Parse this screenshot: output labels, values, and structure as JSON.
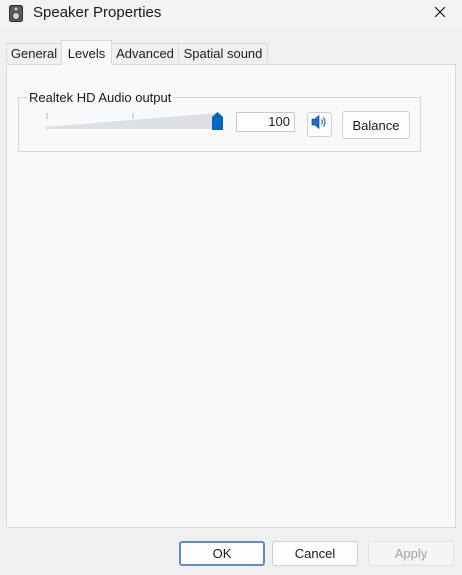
{
  "window": {
    "title": "Speaker Properties",
    "icon": "speaker-device-icon",
    "close_icon": "close-icon"
  },
  "tabs": [
    {
      "label": "General",
      "selected": false
    },
    {
      "label": "Levels",
      "selected": true
    },
    {
      "label": "Advanced",
      "selected": false
    },
    {
      "label": "Spatial sound",
      "selected": false
    }
  ],
  "levels": {
    "group_label": "Realtek HD Audio output",
    "volume_value": "100",
    "volume_fraction": 1.0,
    "mute_icon": "speaker-volume-icon",
    "balance_label": "Balance",
    "accent_color": "#0067c0"
  },
  "footer": {
    "ok_label": "OK",
    "cancel_label": "Cancel",
    "apply_label": "Apply",
    "apply_enabled": false
  }
}
